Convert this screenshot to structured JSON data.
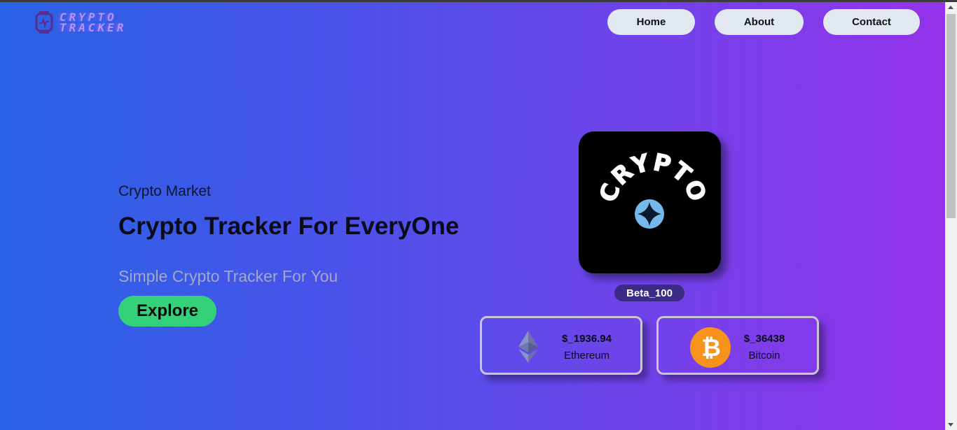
{
  "brand": {
    "line1": "CRYPTO",
    "line2": "TRACKER"
  },
  "nav": {
    "home": "Home",
    "about": "About",
    "contact": "Contact"
  },
  "hero": {
    "subtitle": "Crypto Market",
    "title": "Crypto Tracker For EveryOne",
    "tagline": "Simple Crypto Tracker For You",
    "cta": "Explore"
  },
  "showcase": {
    "logo_text": "CRYPTO",
    "badge": "Beta_100"
  },
  "coins": [
    {
      "price": "$_1936.94",
      "name": "Ethereum",
      "icon": "ethereum-icon"
    },
    {
      "price": "$_36438",
      "name": "Bitcoin",
      "icon": "bitcoin-icon"
    }
  ],
  "colors": {
    "gradient_start": "#2863e6",
    "gradient_end": "#9333ea",
    "nav_button": "#e2e8f0",
    "cta_button": "#34d17a",
    "badge": "#3b2a86",
    "bitcoin": "#f7931a"
  }
}
